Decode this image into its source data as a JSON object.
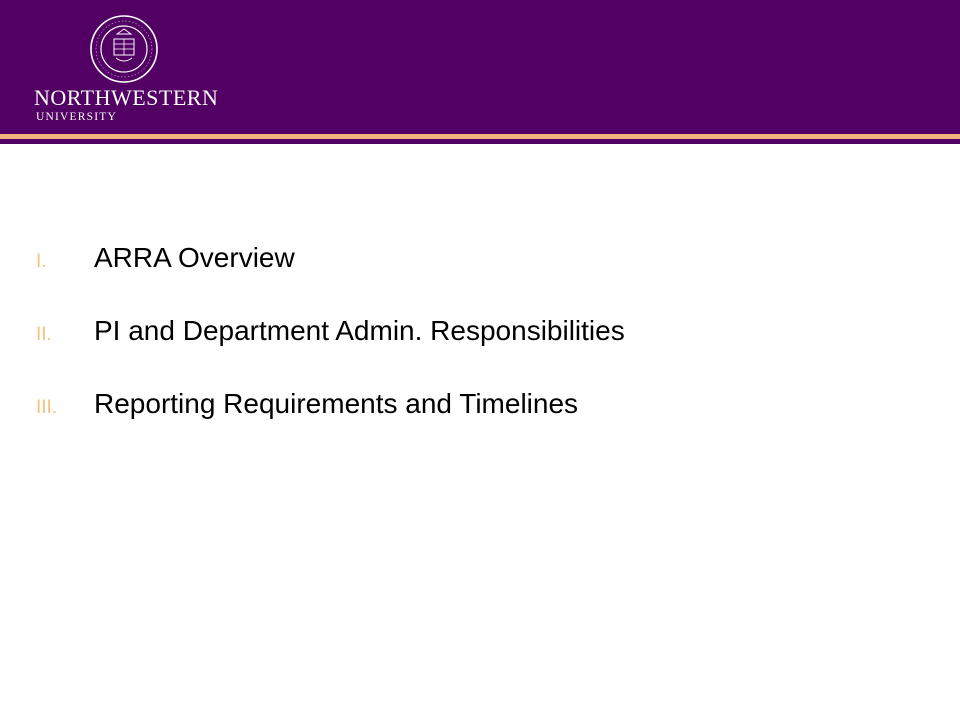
{
  "logo": {
    "seal_icon": "university-seal-icon",
    "seal_text": "NORTHWESTERN UNIVERSITY · 1851",
    "name": "NORTHWESTERN",
    "sub": "UNIVERSITY"
  },
  "colors": {
    "brand_purple": "#520063",
    "accent_peach": "#f0b27f",
    "numeral_gold": "#f0c27a"
  },
  "agenda": {
    "items": [
      {
        "numeral": "I.",
        "text": "ARRA Overview"
      },
      {
        "numeral": "II.",
        "text": "PI and Department Admin. Responsibilities"
      },
      {
        "numeral": "III.",
        "text": "Reporting Requirements and Timelines"
      }
    ]
  }
}
